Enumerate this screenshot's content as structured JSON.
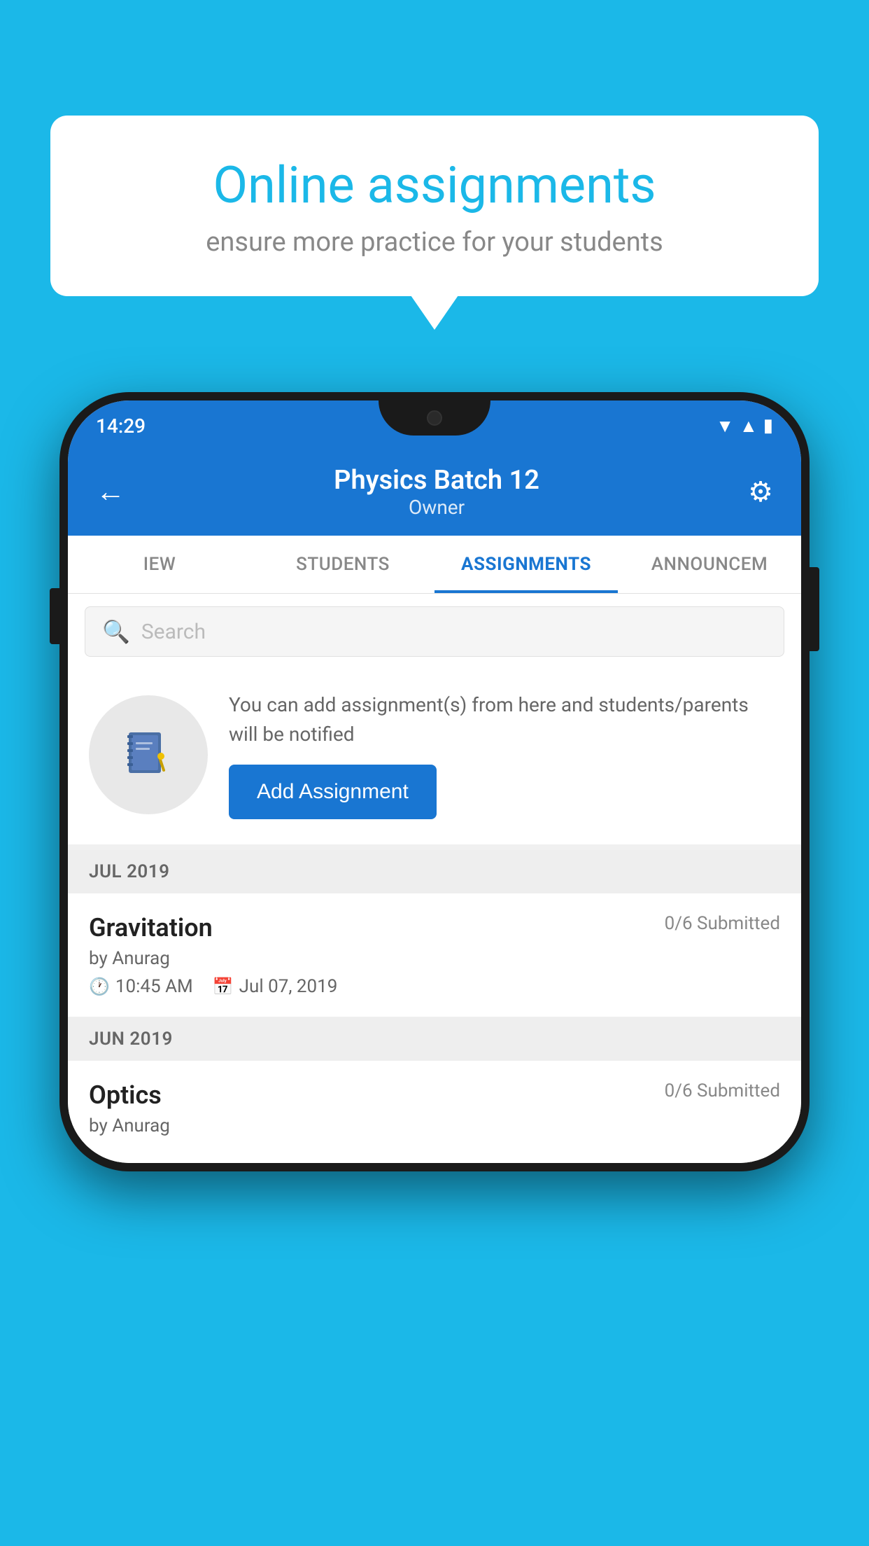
{
  "background": {
    "color": "#1bb8e8"
  },
  "speechBubble": {
    "title": "Online assignments",
    "subtitle": "ensure more practice for your students"
  },
  "phone": {
    "statusBar": {
      "time": "14:29"
    },
    "header": {
      "title": "Physics Batch 12",
      "subtitle": "Owner",
      "backLabel": "←",
      "gearLabel": "⚙"
    },
    "tabs": [
      {
        "label": "IEW",
        "active": false
      },
      {
        "label": "STUDENTS",
        "active": false
      },
      {
        "label": "ASSIGNMENTS",
        "active": true
      },
      {
        "label": "ANNOUNCEM",
        "active": false
      }
    ],
    "search": {
      "placeholder": "Search"
    },
    "infoCard": {
      "text": "You can add assignment(s) from here and students/parents will be notified",
      "buttonLabel": "Add Assignment"
    },
    "sections": [
      {
        "label": "JUL 2019",
        "assignments": [
          {
            "name": "Gravitation",
            "submitted": "0/6 Submitted",
            "by": "by Anurag",
            "time": "10:45 AM",
            "date": "Jul 07, 2019"
          }
        ]
      },
      {
        "label": "JUN 2019",
        "assignments": [
          {
            "name": "Optics",
            "submitted": "0/6 Submitted",
            "by": "by Anurag",
            "time": "",
            "date": ""
          }
        ]
      }
    ]
  }
}
